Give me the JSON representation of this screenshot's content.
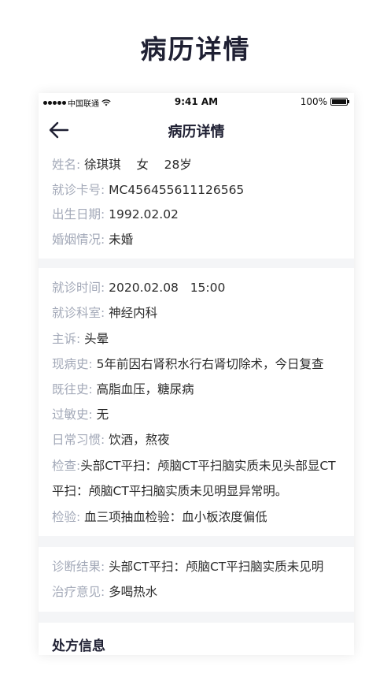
{
  "banner": {
    "title": "病历详情"
  },
  "status_bar": {
    "carrier": "中国联通",
    "time": "9:41 AM",
    "battery": "100%"
  },
  "nav": {
    "title": "病历详情"
  },
  "patient": {
    "name_label": "姓名:",
    "name_value": "徐琪琪    女    28岁",
    "card_label": "就诊卡号:",
    "card_value": "MC456455611126565",
    "birth_label": "出生日期:",
    "birth_value": "1992.02.02",
    "marital_label": "婚姻情况:",
    "marital_value": "未婚"
  },
  "visit": {
    "time_label": "就诊时间:",
    "time_value": "2020.02.08   15:00",
    "dept_label": "就诊科室:",
    "dept_value": "神经内科",
    "complaint_label": "主诉:",
    "complaint_value": "头晕",
    "present_label": "现病史:",
    "present_value": "5年前因右肾积水行右肾切除术，今日复查",
    "past_label": "既往史:",
    "past_value": "高脂血压，糖尿病",
    "allergy_label": "过敏史:",
    "allergy_value": "无",
    "habit_label": "日常习惯:",
    "habit_value": "饮酒，熬夜",
    "exam_label": "检查:",
    "exam_value": "头部CT平扫：颅脑CT平扫脑实质未见头部显CT平扫：颅脑CT平扫脑实质未见明显异常明。",
    "lab_label": "检验:",
    "lab_value": "血三项抽血检验：血小板浓度偏低"
  },
  "diagnosis": {
    "result_label": "诊断结果:",
    "result_value": "头部CT平扫：颅脑CT平扫脑实质未见明",
    "advice_label": "治疗意见:",
    "advice_value": "多喝热水"
  },
  "prescription": {
    "title": "处方信息"
  }
}
